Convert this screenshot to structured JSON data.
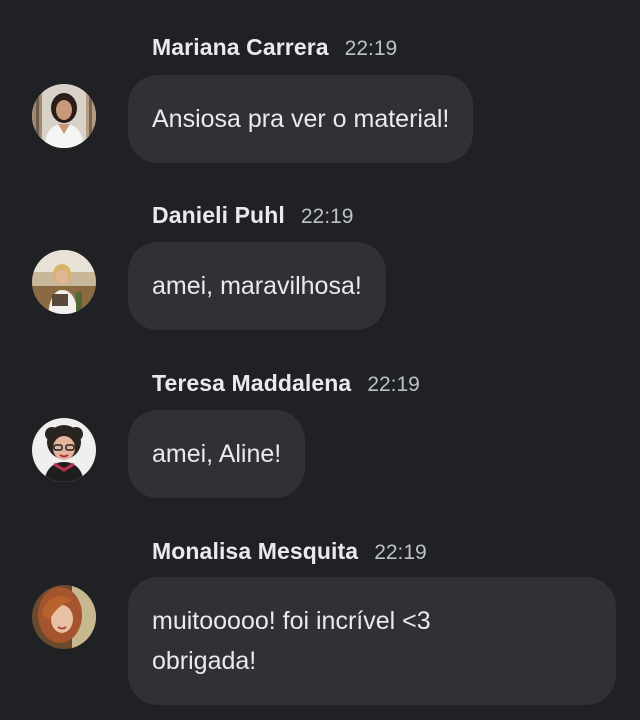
{
  "messages": [
    {
      "sender": "Mariana Carrera",
      "time": "22:19",
      "text": "Ansiosa pra ver o material!",
      "avatar_icon": "avatar-photo-woman-white-shirt"
    },
    {
      "sender": "Danieli Puhl",
      "time": "22:19",
      "text": "amei, maravilhosa!",
      "avatar_icon": "avatar-photo-woman-outdoors"
    },
    {
      "sender": "Teresa Maddalena",
      "time": "22:19",
      "text": "amei, Aline!",
      "avatar_icon": "avatar-photo-woman-glasses"
    },
    {
      "sender": "Monalisa Mesquita",
      "time": "22:19",
      "text": "muitooooo! foi incrível <3\nobrigada!",
      "avatar_icon": "avatar-photo-woman-red-hair"
    }
  ],
  "colors": {
    "background": "#202124",
    "bubble": "#303134",
    "text": "#e8eaed",
    "timestamp": "#bdc1c6"
  }
}
